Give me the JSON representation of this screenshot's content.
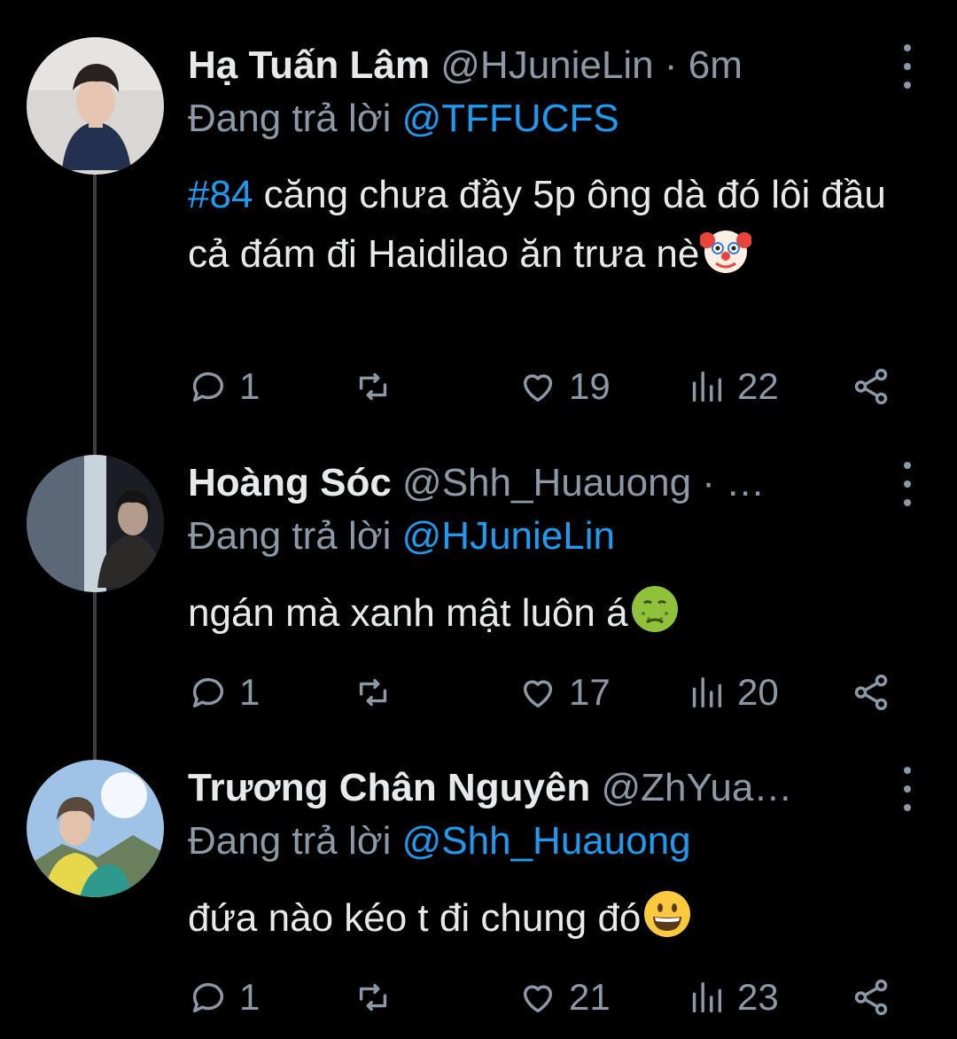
{
  "tweets": [
    {
      "display_name": "Hạ Tuấn Lâm",
      "handle": "@HJunieLin",
      "time_sep": " · ",
      "time": "6m",
      "reply_prefix": "Đang trả lời ",
      "reply_handle": "@TFFUCFS",
      "hashtag": "#84",
      "text": " căng chưa đầy 5p ông dà đó lôi đầu cả đám đi Haidilao ăn trưa nè",
      "emoji": "clown-face",
      "replies": "1",
      "retweets": "",
      "likes": "19",
      "views": "22"
    },
    {
      "display_name": "Hoàng Sóc",
      "handle": "@Shh_Huauong",
      "time_sep": " · …",
      "time": "",
      "reply_prefix": "Đang trả lời ",
      "reply_handle": "@HJunieLin",
      "hashtag": "",
      "text": "ngán mà xanh mật luôn á",
      "emoji": "nauseated-face",
      "replies": "1",
      "retweets": "",
      "likes": "17",
      "views": "20"
    },
    {
      "display_name": "Trương Chân Nguyên",
      "handle": "@ZhYua…",
      "time_sep": "",
      "time": "",
      "reply_prefix": "Đang trả lời ",
      "reply_handle": "@Shh_Huauong",
      "hashtag": "",
      "text": "đứa nào kéo t đi chung đó",
      "emoji": "grinning-face",
      "replies": "1",
      "retweets": "",
      "likes": "21",
      "views": "23"
    }
  ],
  "colors": {
    "background": "#000000",
    "text": "#e7e9ea",
    "muted": "#8b98a5",
    "link": "#1d9bf0",
    "thread_line": "#3a3f44"
  }
}
